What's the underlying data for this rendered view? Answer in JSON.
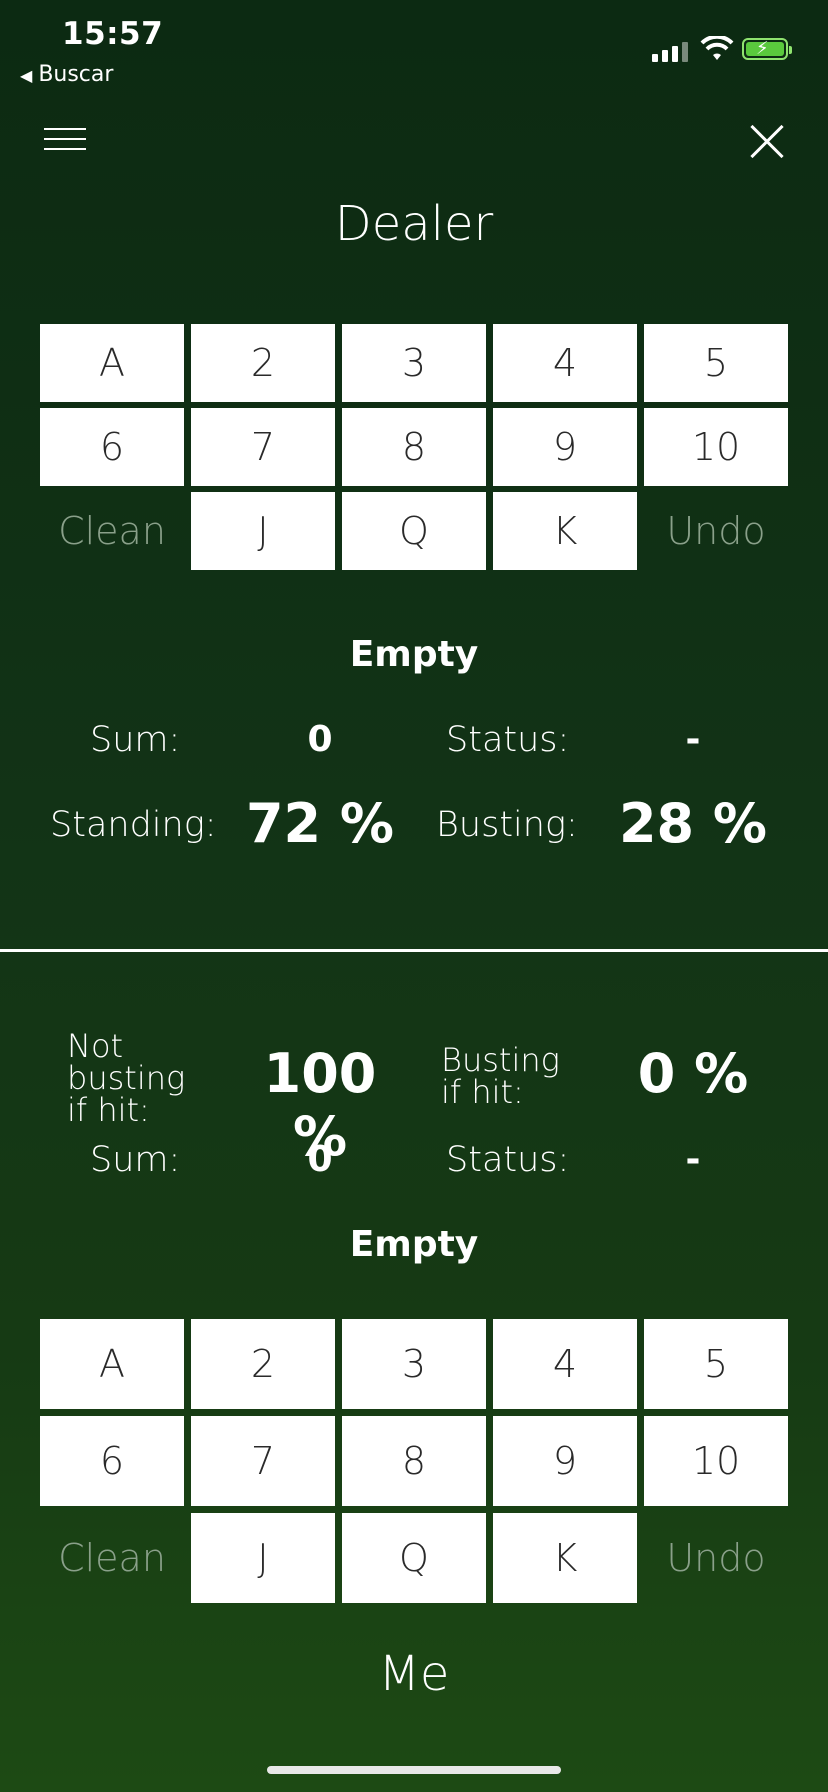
{
  "status_bar": {
    "time": "15:57",
    "back_label": "Buscar"
  },
  "dealer": {
    "title": "Dealer",
    "keys": [
      "A",
      "2",
      "3",
      "4",
      "5",
      "6",
      "7",
      "8",
      "9",
      "10"
    ],
    "bottom_row": {
      "clean": "Clean",
      "faces": [
        "J",
        "Q",
        "K"
      ],
      "undo": "Undo"
    },
    "hand": "Empty",
    "sum_label": "Sum:",
    "sum_value": "0",
    "status_label": "Status:",
    "status_value": "-",
    "standing_label": "Standing:",
    "standing_value": "72 %",
    "busting_label": "Busting:",
    "busting_value": "28 %"
  },
  "me": {
    "title": "Me",
    "not_busting_label": "Not busting if hit:",
    "not_busting_value": "100 %",
    "busting_label": "Busting if hit:",
    "busting_value": "0 %",
    "sum_label": "Sum:",
    "sum_value": "0",
    "status_label": "Status:",
    "status_value": "-",
    "hand": "Empty",
    "keys": [
      "A",
      "2",
      "3",
      "4",
      "5",
      "6",
      "7",
      "8",
      "9",
      "10"
    ],
    "bottom_row": {
      "clean": "Clean",
      "faces": [
        "J",
        "Q",
        "K"
      ],
      "undo": "Undo"
    }
  },
  "colors": {
    "background_top": "#0c2a12",
    "background_bottom": "#1d4a14",
    "key_bg": "#ffffff",
    "muted_text": "#8aa08a"
  }
}
